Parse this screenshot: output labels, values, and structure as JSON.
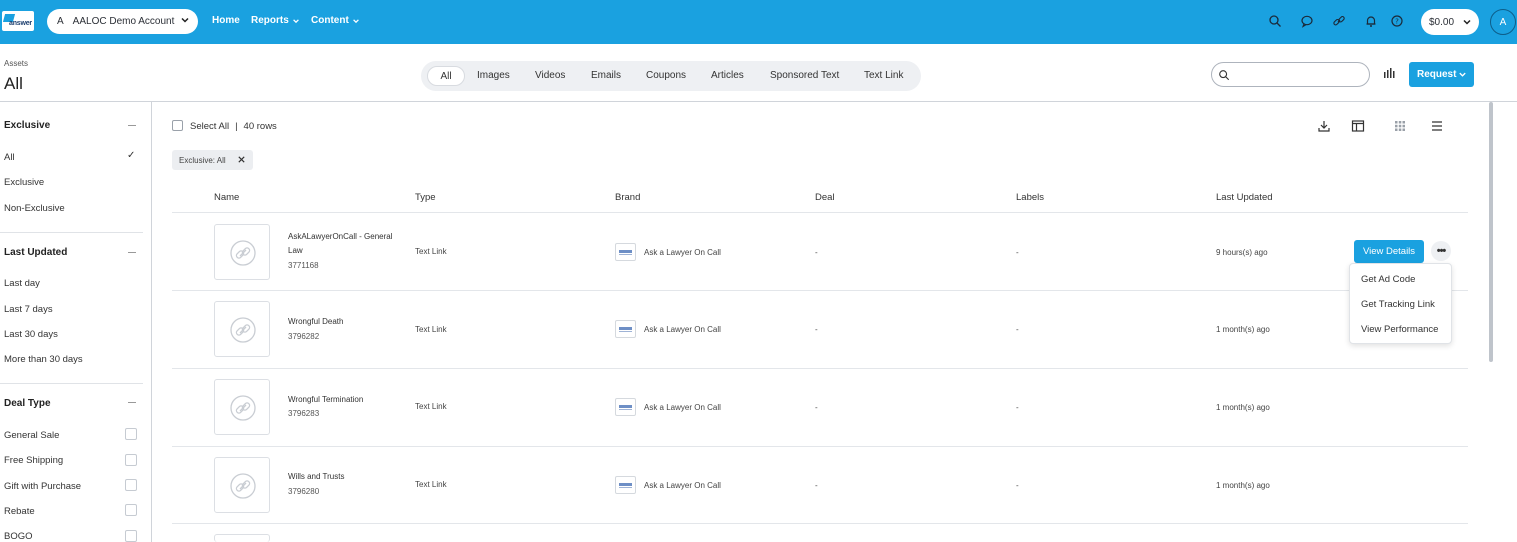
{
  "app": {
    "logo_text": "answer",
    "account_letter": "A",
    "account_name": "AALOC Demo Account",
    "nav": {
      "home": "Home",
      "reports": "Reports",
      "content": "Content"
    },
    "balance": "$0.00",
    "avatar": "A"
  },
  "header": {
    "breadcrumb": "Assets",
    "title": "All",
    "tabs": [
      "All",
      "Images",
      "Videos",
      "Emails",
      "Coupons",
      "Articles",
      "Sponsored Text",
      "Text Link"
    ],
    "active_tab": "All",
    "search_placeholder": "",
    "request_label": "Request"
  },
  "sidebar": {
    "exclusive": {
      "title": "Exclusive",
      "options": [
        "All",
        "Exclusive",
        "Non-Exclusive"
      ],
      "selected": "All"
    },
    "last_updated": {
      "title": "Last Updated",
      "options": [
        "Last day",
        "Last 7 days",
        "Last 30 days",
        "More than 30 days"
      ]
    },
    "deal_type": {
      "title": "Deal Type",
      "options": [
        "General Sale",
        "Free Shipping",
        "Gift with Purchase",
        "Rebate",
        "BOGO"
      ]
    }
  },
  "main": {
    "select_all": "Select All",
    "row_count": "40 rows",
    "filter_chip": "Exclusive: All",
    "columns": [
      "Name",
      "Type",
      "Brand",
      "Deal",
      "Labels",
      "Last Updated"
    ],
    "rows": [
      {
        "name": "AskALawyerOnCall - General Law",
        "id": "3771168",
        "type": "Text Link",
        "brand": "Ask a Lawyer On Call",
        "deal": "-",
        "labels": "-",
        "updated": "9 hours(s) ago"
      },
      {
        "name": "Wrongful Death",
        "id": "3796282",
        "type": "Text Link",
        "brand": "Ask a Lawyer On Call",
        "deal": "-",
        "labels": "-",
        "updated": "1 month(s) ago"
      },
      {
        "name": "Wrongful Termination",
        "id": "3796283",
        "type": "Text Link",
        "brand": "Ask a Lawyer On Call",
        "deal": "-",
        "labels": "-",
        "updated": "1 month(s) ago"
      },
      {
        "name": "Wills and Trusts",
        "id": "3796280",
        "type": "Text Link",
        "brand": "Ask a Lawyer On Call",
        "deal": "-",
        "labels": "-",
        "updated": "1 month(s) ago"
      }
    ],
    "view_details": "View Details",
    "more": "•••",
    "menu": [
      "Get Ad Code",
      "Get Tracking Link",
      "View Performance"
    ]
  }
}
